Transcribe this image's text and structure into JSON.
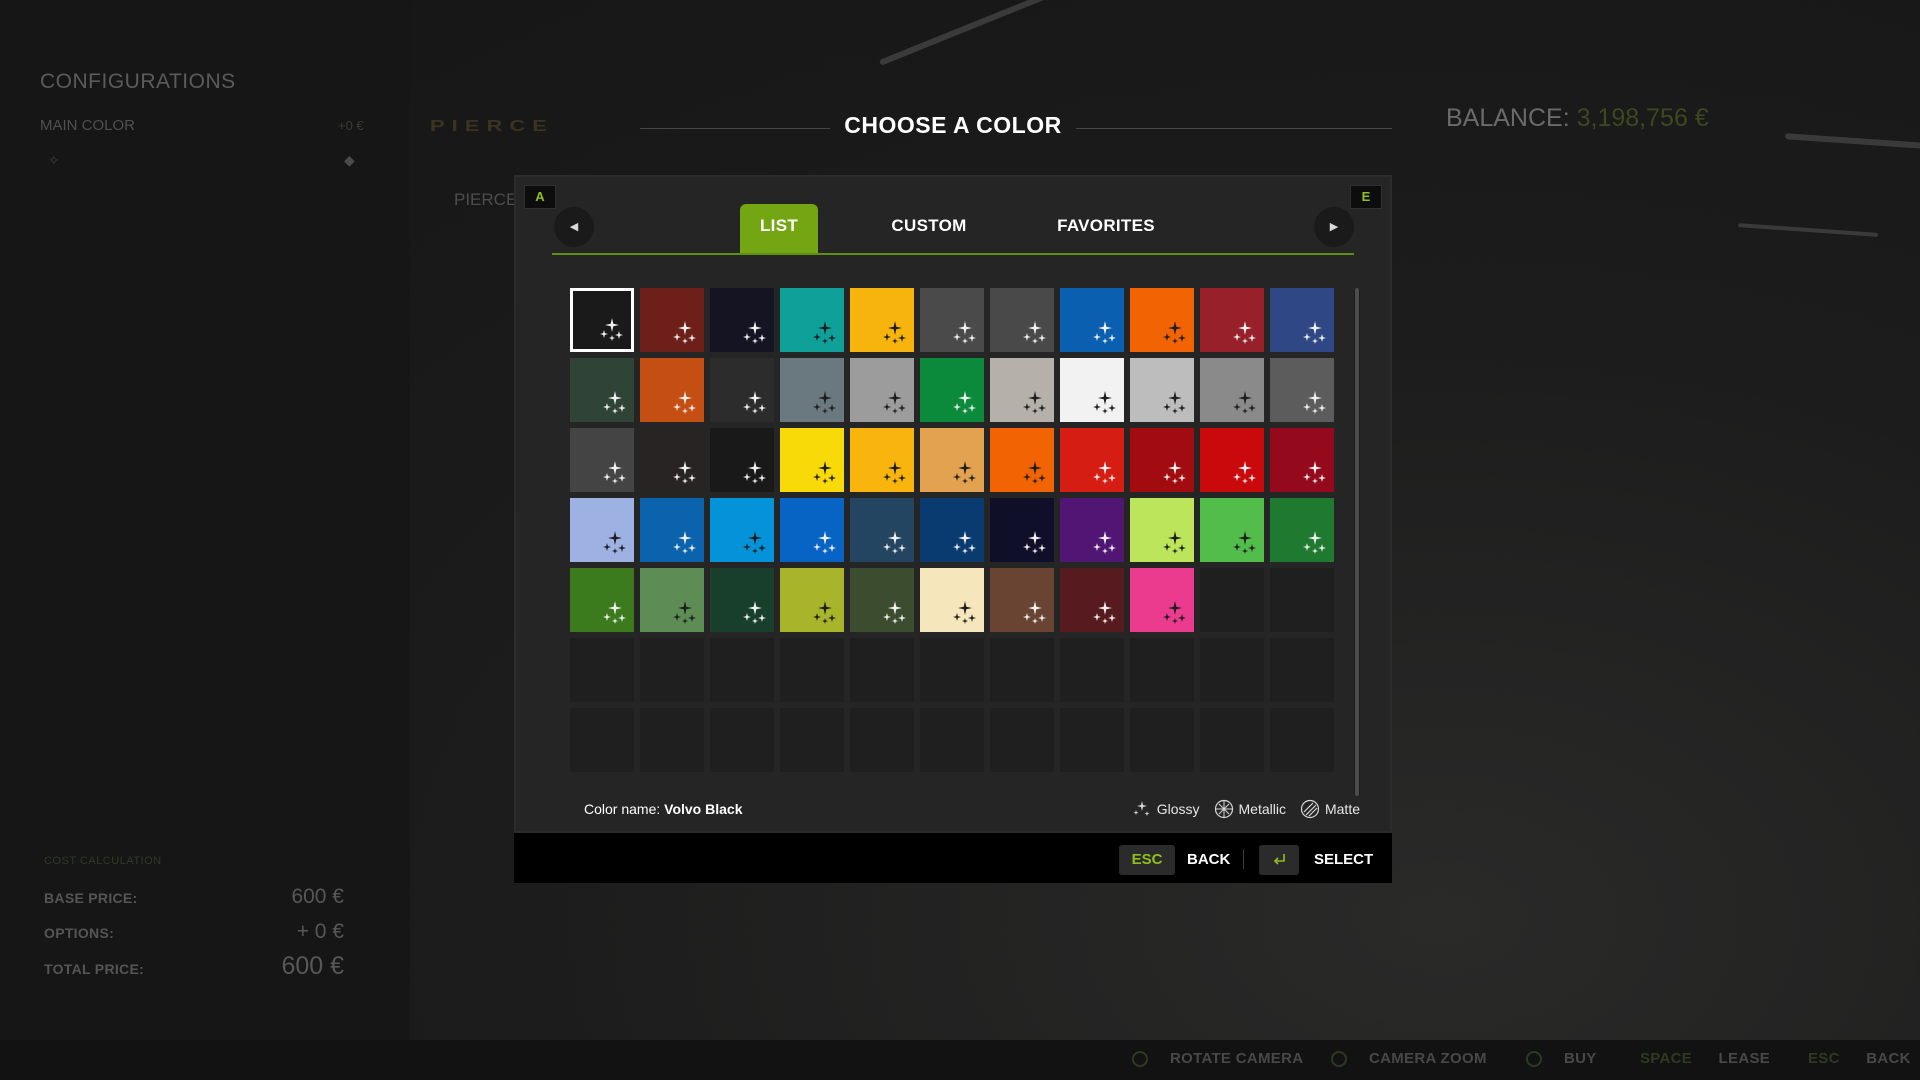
{
  "left_panel": {
    "title": "CONFIGURATIONS",
    "main_color_label": "MAIN COLOR",
    "main_color_price": "+0 €",
    "cost_heading": "COST CALCULATION",
    "base_price_label": "BASE PRICE:",
    "base_price_value": "600 €",
    "options_label": "OPTIONS:",
    "options_value": "+ 0 €",
    "total_price_label": "TOTAL PRICE:",
    "total_price_value": "600 €"
  },
  "background": {
    "brand_logo": "PIERCE",
    "subtitle": "PIERCE",
    "balance_label": "BALANCE:",
    "balance_value": "3,198,756 €"
  },
  "dialog": {
    "title": "CHOOSE A COLOR",
    "key_left": "A",
    "key_right": "E",
    "nav_prev_icon": "caret-left-icon",
    "nav_next_icon": "caret-right-icon",
    "tabs": [
      {
        "label": "LIST",
        "active": true
      },
      {
        "label": "CUSTOM",
        "active": false
      },
      {
        "label": "FAVORITES",
        "active": false
      }
    ],
    "colors": [
      {
        "hex": "#1a1a1a",
        "icon": "light",
        "selected": true
      },
      {
        "hex": "#6e1f19",
        "icon": "light"
      },
      {
        "hex": "#141423",
        "icon": "light"
      },
      {
        "hex": "#10a09a",
        "icon": "dark"
      },
      {
        "hex": "#f7b40c",
        "icon": "dark"
      },
      {
        "hex": "#4a4a4a",
        "icon": "light"
      },
      {
        "hex": "#494949",
        "icon": "light"
      },
      {
        "hex": "#0b5fb0",
        "icon": "light"
      },
      {
        "hex": "#f26304",
        "icon": "dark"
      },
      {
        "hex": "#98202a",
        "icon": "light"
      },
      {
        "hex": "#2f4885",
        "icon": "light"
      },
      {
        "hex": "#2f4436",
        "icon": "light"
      },
      {
        "hex": "#c54e13",
        "icon": "light"
      },
      {
        "hex": "#2c2c2c",
        "icon": "light"
      },
      {
        "hex": "#6a7980",
        "icon": "dark"
      },
      {
        "hex": "#9c9c9c",
        "icon": "dark"
      },
      {
        "hex": "#0b8a3c",
        "icon": "light"
      },
      {
        "hex": "#b5b0a9",
        "icon": "dark"
      },
      {
        "hex": "#f2f2f2",
        "icon": "dark"
      },
      {
        "hex": "#bdbdbd",
        "icon": "dark"
      },
      {
        "hex": "#8a8a8a",
        "icon": "dark"
      },
      {
        "hex": "#5c5c5c",
        "icon": "light"
      },
      {
        "hex": "#444444",
        "icon": "light"
      },
      {
        "hex": "#272423",
        "icon": "light"
      },
      {
        "hex": "#191919",
        "icon": "light"
      },
      {
        "hex": "#f8da08",
        "icon": "dark"
      },
      {
        "hex": "#f9b50d",
        "icon": "dark"
      },
      {
        "hex": "#e2a250",
        "icon": "dark"
      },
      {
        "hex": "#f26304",
        "icon": "dark"
      },
      {
        "hex": "#d61d14",
        "icon": "light"
      },
      {
        "hex": "#a20c10",
        "icon": "light"
      },
      {
        "hex": "#c9090c",
        "icon": "light"
      },
      {
        "hex": "#94091c",
        "icon": "light"
      },
      {
        "hex": "#9eb1e3",
        "icon": "dark"
      },
      {
        "hex": "#0b62ad",
        "icon": "light"
      },
      {
        "hex": "#0493d8",
        "icon": "dark"
      },
      {
        "hex": "#0763c4",
        "icon": "light"
      },
      {
        "hex": "#244562",
        "icon": "light"
      },
      {
        "hex": "#093a70",
        "icon": "light"
      },
      {
        "hex": "#0f0f29",
        "icon": "light"
      },
      {
        "hex": "#511673",
        "icon": "light"
      },
      {
        "hex": "#bde55b",
        "icon": "dark"
      },
      {
        "hex": "#52bd4a",
        "icon": "dark"
      },
      {
        "hex": "#1f7a2f",
        "icon": "light"
      },
      {
        "hex": "#3b7b1e",
        "icon": "light"
      },
      {
        "hex": "#5d8c55",
        "icon": "dark"
      },
      {
        "hex": "#183f2c",
        "icon": "light"
      },
      {
        "hex": "#a8b52a",
        "icon": "dark"
      },
      {
        "hex": "#3c4d2f",
        "icon": "light"
      },
      {
        "hex": "#f6e6bb",
        "icon": "dark"
      },
      {
        "hex": "#6a4433",
        "icon": "light"
      },
      {
        "hex": "#571a1e",
        "icon": "light"
      },
      {
        "hex": "#ea3b8f",
        "icon": "dark"
      }
    ],
    "empty_slots": 24,
    "color_name_label": "Color name:",
    "color_name_value": "Volvo Black",
    "legend": [
      {
        "label": "Glossy",
        "icon": "glossy-icon"
      },
      {
        "label": "Metallic",
        "icon": "metallic-icon"
      },
      {
        "label": "Matte",
        "icon": "matte-icon"
      }
    ]
  },
  "footer": {
    "back_key": "ESC",
    "back_label": "BACK",
    "select_key_icon": "enter-key-icon",
    "select_label": "SELECT"
  },
  "bottom_bar": {
    "rotate_camera": "ROTATE CAMERA",
    "camera_zoom": "CAMERA ZOOM",
    "buy": "BUY",
    "lease_key": "SPACE",
    "lease": "LEASE",
    "back_key": "ESC",
    "back": "BACK"
  },
  "colors_ui": {
    "accent": "#74a513",
    "accent_text": "#8fbf1d"
  }
}
